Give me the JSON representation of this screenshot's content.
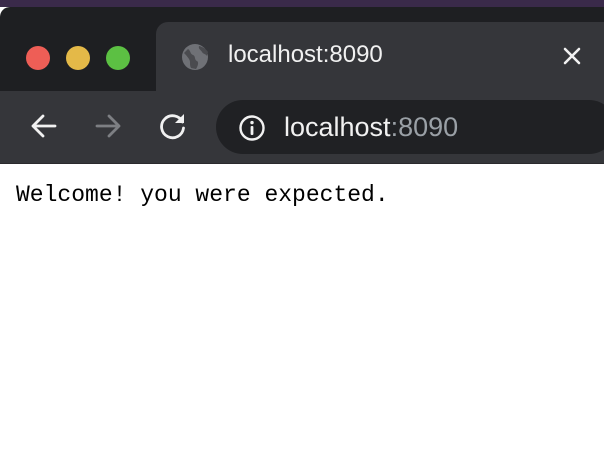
{
  "window": {
    "controls": {
      "close_color": "#ee5e56",
      "minimize_color": "#e4b948",
      "maximize_color": "#5cc043"
    }
  },
  "tab": {
    "title": "localhost:8090",
    "favicon": "globe-icon",
    "close_icon": "close-icon"
  },
  "toolbar": {
    "back_icon": "back-arrow-icon",
    "forward_icon": "forward-arrow-icon",
    "reload_icon": "reload-icon",
    "address": {
      "security_icon": "info-icon",
      "host": "localhost",
      "port": ":8090"
    }
  },
  "page": {
    "text": "Welcome! you were expected."
  },
  "colors": {
    "titlebar": "#1e1f22",
    "toolbar": "#35363a",
    "omnibox": "#202124",
    "page_background": "#ffffff"
  }
}
